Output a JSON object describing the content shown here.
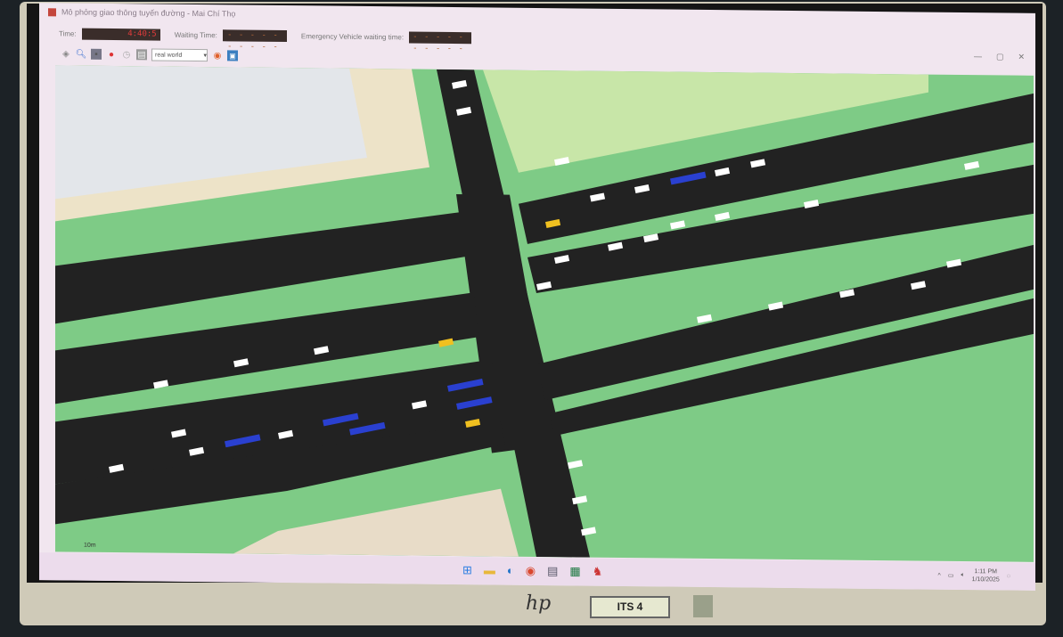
{
  "window": {
    "title": "Mô phỏng giao thông tuyến đường - Mai Chí Thọ",
    "controls": [
      "—",
      "▢",
      "✕"
    ]
  },
  "status": {
    "time_label": "Time:",
    "time_value": "4:40:5",
    "waiting_label": "Waiting Time:",
    "waiting_value": "- - - - - - - - - -",
    "emergency_label": "Emergency Vehicle waiting time:",
    "emergency_value": "- - - - - - - - - -"
  },
  "toolbar": {
    "view_select": "real world",
    "icons": [
      "center-view-icon",
      "zoom-icon",
      "locate-icon",
      "breakpoint-icon",
      "clock-icon",
      "screenshot-icon",
      "color-icon",
      "camera-icon"
    ]
  },
  "map": {
    "scale_label": "10m",
    "road_color": "#222222",
    "grass_color": "#7ecb86"
  },
  "taskbar": {
    "apps": [
      "start-icon",
      "file-explorer-icon",
      "edge-icon",
      "chrome-icon",
      "app-icon",
      "excel-icon",
      "sumo-icon"
    ],
    "time": "1:11 PM",
    "date": "1/10/2025"
  },
  "monitor": {
    "brand": "hp",
    "label": "ITS 4"
  }
}
